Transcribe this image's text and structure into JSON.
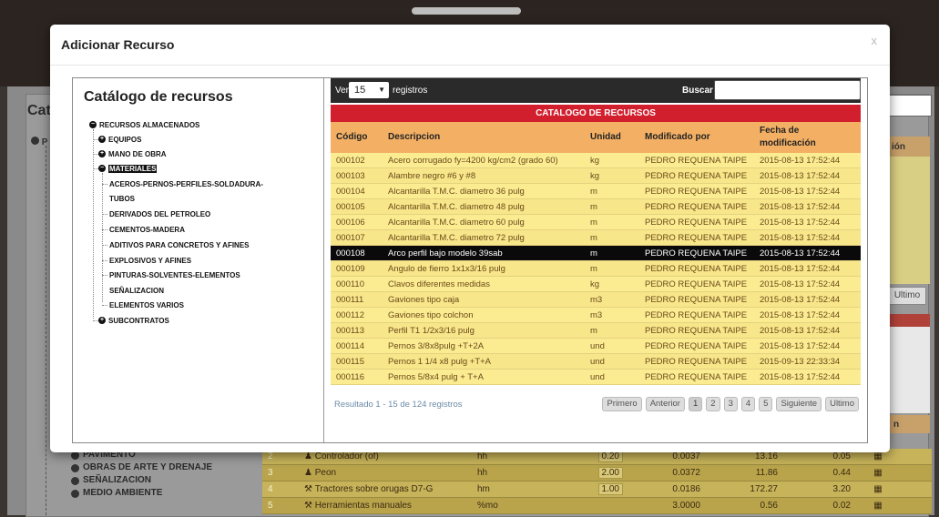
{
  "background": {
    "page_heading": "Cata",
    "side_tree_label": "P",
    "right_header": "ión",
    "right_button": "Ultimo",
    "right_header2": "n",
    "bottom_tree": [
      "PAVIMENTO",
      "OBRAS DE ARTE Y DRENAJE",
      "SEÑALIZACION",
      "MEDIO AMBIENTE"
    ],
    "rows": [
      {
        "n": "2",
        "desc": "Controlador (of)",
        "unit": "hh",
        "a": "0.20",
        "b": "0.0037",
        "c": "13.16",
        "d": "0.05"
      },
      {
        "n": "3",
        "desc": "Peon",
        "unit": "hh",
        "a": "2.00",
        "b": "0.0372",
        "c": "11.86",
        "d": "0.44"
      },
      {
        "n": "4",
        "desc": "Tractores sobre orugas D7-G",
        "unit": "hm",
        "a": "1.00",
        "b": "0.0186",
        "c": "172.27",
        "d": "3.20"
      },
      {
        "n": "5",
        "desc": "Herramientas manuales",
        "unit": "%mo",
        "a": "",
        "b": "3.0000",
        "c": "0.56",
        "d": "0.02"
      }
    ]
  },
  "modal": {
    "title": "Adicionar Recurso",
    "close": "x",
    "left": {
      "title": "Catálogo de recursos",
      "root": "RECURSOS ALMACENADOS",
      "level1": [
        "EQUIPOS",
        "MANO DE OBRA",
        "MATERIALES",
        "SUBCONTRATOS"
      ],
      "materiales": [
        "ACEROS-PERNOS-PERFILES-SOLDADURA-",
        "TUBOS",
        "DERIVADOS DEL PETROLEO",
        "CEMENTOS-MADERA",
        "ADITIVOS PARA CONCRETOS Y AFINES",
        "EXPLOSIVOS Y AFINES",
        "PINTURAS-SOLVENTES-ELEMENTOS",
        "SEÑALIZACION",
        "ELEMENTOS VARIOS"
      ]
    },
    "toolbar": {
      "ver": "Ver",
      "page_size": "15",
      "registros": "registros",
      "buscar": "Buscar :",
      "search_value": ""
    },
    "banner": "CATALOGO DE RECURSOS",
    "columns": [
      "Código",
      "Descripcion",
      "Unidad",
      "Modificado por",
      "Fecha de modificación"
    ],
    "rows": [
      [
        "000102",
        "Acero corrugado fy=4200 kg/cm2 (grado 60)",
        "kg",
        "PEDRO REQUENA TAIPE",
        "2015-08-13 17:52:44"
      ],
      [
        "000103",
        "Alambre negro #6 y #8",
        "kg",
        "PEDRO REQUENA TAIPE",
        "2015-08-13 17:52:44"
      ],
      [
        "000104",
        "Alcantarilla T.M.C. diametro 36 pulg",
        "m",
        "PEDRO REQUENA TAIPE",
        "2015-08-13 17:52:44"
      ],
      [
        "000105",
        "Alcantarilla T.M.C. diametro 48 pulg",
        "m",
        "PEDRO REQUENA TAIPE",
        "2015-08-13 17:52:44"
      ],
      [
        "000106",
        "Alcantarilla T.M.C. diametro 60 pulg",
        "m",
        "PEDRO REQUENA TAIPE",
        "2015-08-13 17:52:44"
      ],
      [
        "000107",
        "Alcantarilla T.M.C. diametro 72 pulg",
        "m",
        "PEDRO REQUENA TAIPE",
        "2015-08-13 17:52:44"
      ],
      [
        "000108",
        "Arco perfil bajo modelo 39sab",
        "m",
        "PEDRO REQUENA TAIPE",
        "2015-08-13 17:52:44"
      ],
      [
        "000109",
        "Angulo de fierro 1x1x3/16 pulg",
        "m",
        "PEDRO REQUENA TAIPE",
        "2015-08-13 17:52:44"
      ],
      [
        "000110",
        "Clavos diferentes medidas",
        "kg",
        "PEDRO REQUENA TAIPE",
        "2015-08-13 17:52:44"
      ],
      [
        "000111",
        "Gaviones tipo caja",
        "m3",
        "PEDRO REQUENA TAIPE",
        "2015-08-13 17:52:44"
      ],
      [
        "000112",
        "Gaviones tipo colchon",
        "m3",
        "PEDRO REQUENA TAIPE",
        "2015-08-13 17:52:44"
      ],
      [
        "000113",
        "Perfil T1 1/2x3/16 pulg",
        "m",
        "PEDRO REQUENA TAIPE",
        "2015-08-13 17:52:44"
      ],
      [
        "000114",
        "Pernos 3/8x8pulg +T+2A",
        "und",
        "PEDRO REQUENA TAIPE",
        "2015-08-13 17:52:44"
      ],
      [
        "000115",
        "Pernos 1 1/4 x8 pulg +T+A",
        "und",
        "PEDRO REQUENA TAIPE",
        "2015-09-13 22:33:34"
      ],
      [
        "000116",
        "Pernos 5/8x4 pulg + T+A",
        "und",
        "PEDRO REQUENA TAIPE",
        "2015-08-13 17:52:44"
      ]
    ],
    "selected_code": "000108",
    "result_text": "Resultado 1 - 15 de 124 registros",
    "pager": [
      "Primero",
      "Anterior",
      "1",
      "2",
      "3",
      "4",
      "5",
      "Siguiente",
      "Ultimo"
    ],
    "current_page": "1"
  }
}
